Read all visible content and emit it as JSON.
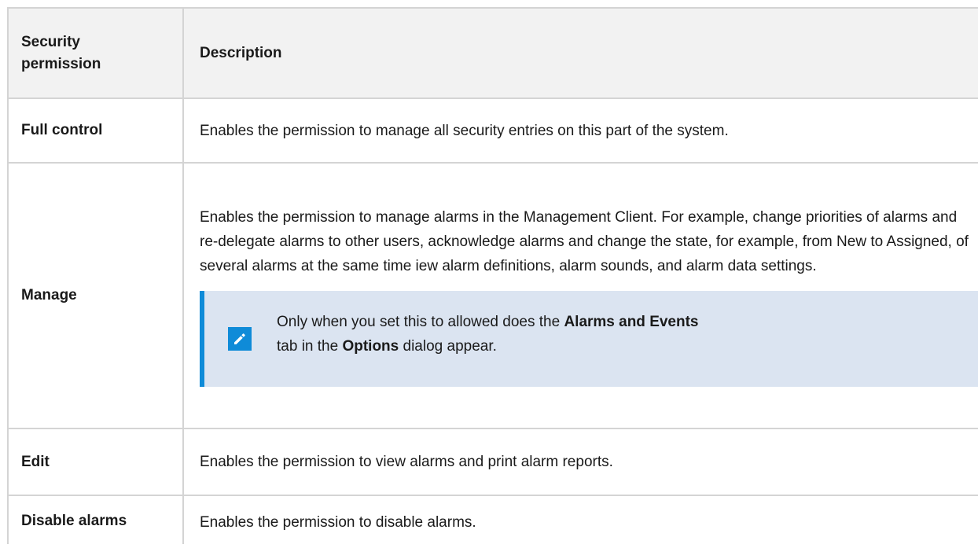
{
  "table": {
    "header": {
      "col1_line1": "Security",
      "col1_line2": "permission",
      "col2": "Description"
    },
    "rows": [
      {
        "permission": "Full control",
        "description": "Enables the permission to manage all security entries on this part of the system."
      },
      {
        "permission": "Manage",
        "description": "Enables the permission to manage alarms in the Management Client. For example, change priorities of alarms and re-delegate alarms to other users, acknowledge alarms and change the state, for example, from New to Assigned, of several alarms at the same time iew alarm definitions, alarm sounds, and alarm data settings.",
        "note": {
          "icon": "pencil-icon",
          "part1": "Only when you set this to allowed does the ",
          "bold1": "Alarms and Events",
          "part2": " tab in the ",
          "bold2": "Options",
          "part3": " dialog appear."
        }
      },
      {
        "permission": "Edit",
        "description": "Enables the permission to view alarms and print alarm reports."
      },
      {
        "permission": "Disable alarms",
        "description": "Enables the permission to disable alarms."
      }
    ]
  },
  "colors": {
    "header_bg": "#f2f2f2",
    "note_bg": "#dbe4f1",
    "accent": "#0f8bd8",
    "border": "#d4d4d4"
  }
}
